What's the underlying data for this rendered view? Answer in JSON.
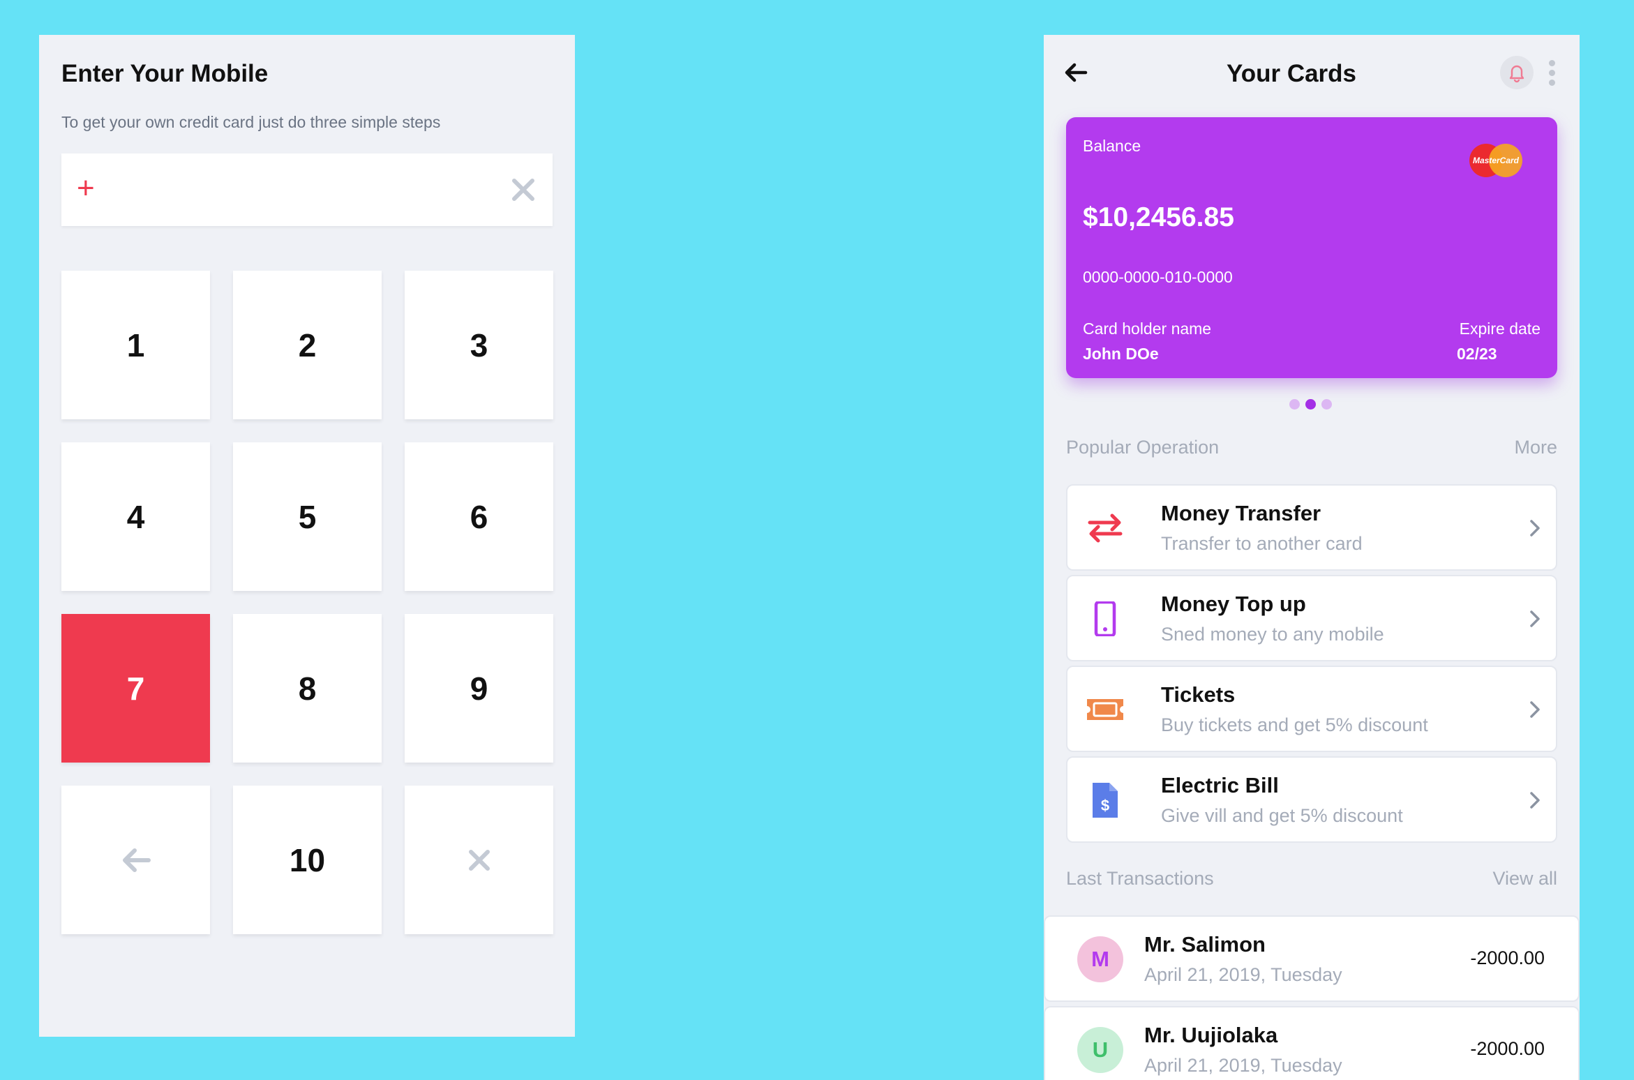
{
  "left": {
    "title": "Enter Your Mobile",
    "subtitle": "To get your own credit card just do three simple steps",
    "phone_prefix": "+",
    "phone_value": "",
    "keys": [
      "1",
      "2",
      "3",
      "4",
      "5",
      "6",
      "7",
      "8",
      "9",
      "10"
    ],
    "active_key": "7",
    "backspace_icon": "arrow-left-icon",
    "clear_icon": "close-icon"
  },
  "right": {
    "title": "Your Cards",
    "card": {
      "balance_label": "Balance",
      "balance": "$10,2456.85",
      "number": "0000-0000-010-0000",
      "holder_label": "Card holder name",
      "holder_name": "John DOe",
      "expiry_label": "Expire date",
      "expiry": "02/23",
      "brand": "MasterCard",
      "color": "#b33bee"
    },
    "carousel": {
      "pages": 3,
      "active": 2
    },
    "popular": {
      "heading": "Popular Operation",
      "link": "More",
      "items": [
        {
          "title": "Money Transfer",
          "subtitle": "Transfer to another card",
          "icon": "transfer-icon",
          "color": "#ef3a4f"
        },
        {
          "title": "Money Top up",
          "subtitle": "Sned money to any mobile",
          "icon": "mobile-phone-icon",
          "color": "#b33bee"
        },
        {
          "title": "Tickets",
          "subtitle": "Buy tickets and get 5% discount",
          "icon": "ticket-icon",
          "color": "#f0884a"
        },
        {
          "title": "Electric Bill",
          "subtitle": "Give vill and get 5% discount",
          "icon": "bill-icon",
          "color": "#5b7de8"
        }
      ]
    },
    "transactions": {
      "heading": "Last Transactions",
      "link": "View all",
      "items": [
        {
          "initial": "M",
          "name": "Mr. Salimon",
          "date": "April 21, 2019, Tuesday",
          "amount": "-2000.00",
          "avatar_bg": "#f3c2dc",
          "avatar_fg": "#b33bee"
        },
        {
          "initial": "U",
          "name": "Mr. Uujiolaka",
          "date": "April 21, 2019, Tuesday",
          "amount": "-2000.00",
          "avatar_bg": "#c8efd7",
          "avatar_fg": "#3fbf6b"
        }
      ]
    }
  },
  "colors": {
    "background": "#65e2f6",
    "panel": "#eff1f6",
    "accent_red": "#ef3a4f",
    "accent_purple": "#b33bee"
  }
}
